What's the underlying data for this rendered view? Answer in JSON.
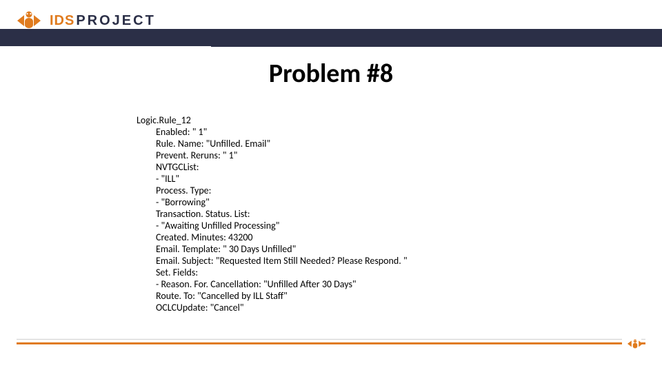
{
  "brand": {
    "ids": "IDS",
    "project": "PROJECT"
  },
  "title": "Problem #8",
  "rule": {
    "name": "Logic.Rule_12",
    "lines": [
      "Enabled: \" 1\"",
      "Rule. Name: \"Unfilled. Email\"",
      "Prevent. Reruns: \" 1\"",
      "NVTGCList:",
      "- \"ILL\"",
      "Process. Type:",
      "- \"Borrowing\"",
      "Transaction. Status. List:",
      "- \"Awaiting Unfilled Processing\"",
      "Created. Minutes: 43200",
      "Email. Template: \" 30 Days Unfilled\"",
      "Email. Subject: \"Requested Item Still Needed? Please Respond. \"",
      "Set. Fields:",
      "- Reason. For. Cancellation: \"Unfilled After 30 Days\"",
      "Route. To: \"Cancelled by ILL Staff\"",
      "OCLCUpdate: \"Cancel\""
    ]
  }
}
